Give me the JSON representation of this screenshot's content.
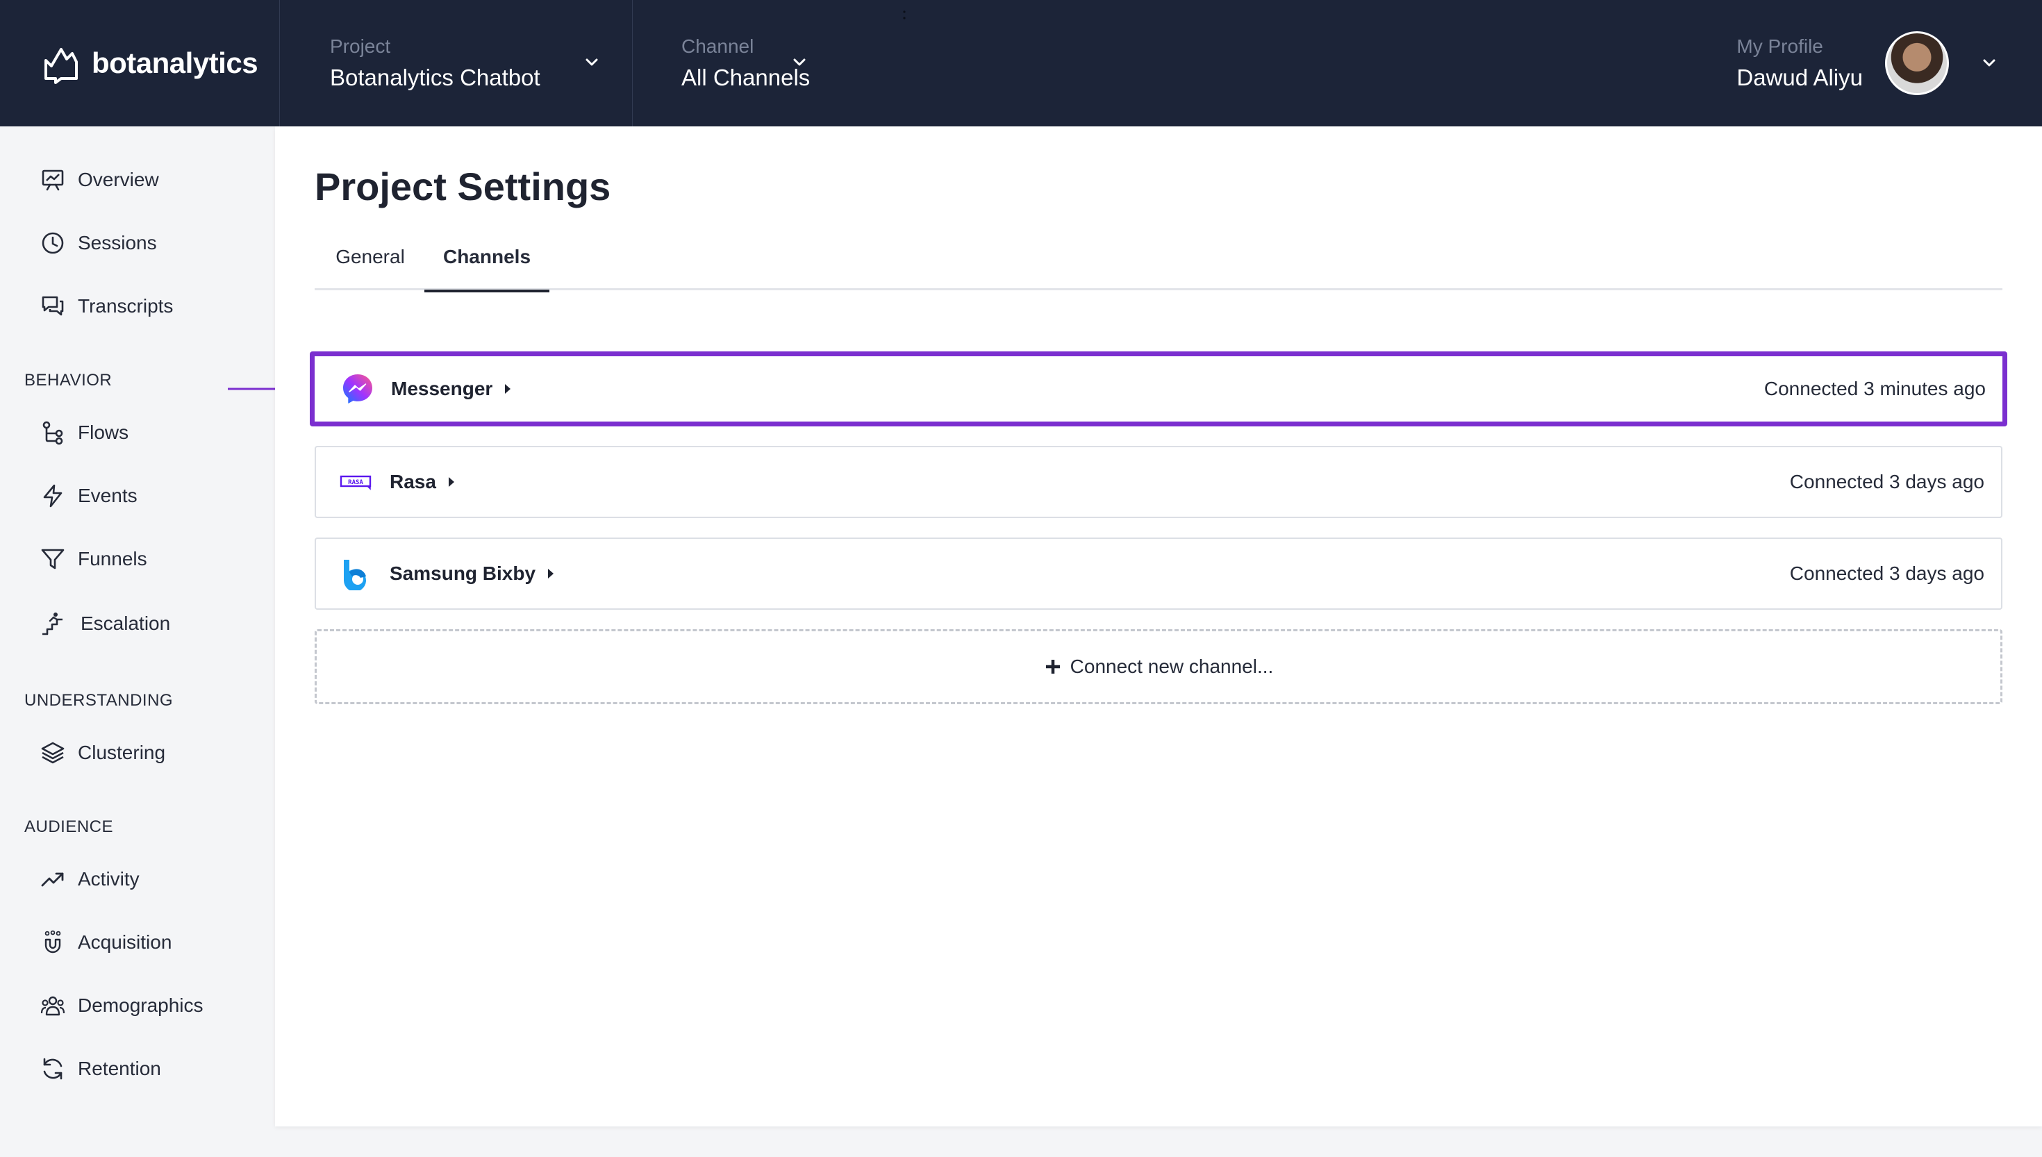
{
  "colors": {
    "topbar_bg": "#1c2438",
    "highlight_border": "#7b2fcf",
    "text_dark": "#1f2330"
  },
  "brand": {
    "name": "botanalytics",
    "icon": "botanalytics-logo-icon"
  },
  "header": {
    "project": {
      "label": "Project",
      "value": "Botanalytics Chatbot"
    },
    "channel": {
      "label": "Channel",
      "value": "All Channels"
    },
    "profile": {
      "label": "My Profile",
      "name": "Dawud Aliyu"
    }
  },
  "sidebar": {
    "top_items": [
      {
        "label": "Overview",
        "icon": "presentation-chart-icon"
      },
      {
        "label": "Sessions",
        "icon": "clock-icon"
      },
      {
        "label": "Transcripts",
        "icon": "chat-bubbles-icon"
      }
    ],
    "sections": [
      {
        "title": "BEHAVIOR",
        "items": [
          {
            "label": "Flows",
            "icon": "flow-icon"
          },
          {
            "label": "Events",
            "icon": "lightning-icon"
          },
          {
            "label": "Funnels",
            "icon": "funnel-icon"
          },
          {
            "label": "Escalation",
            "icon": "escalation-stairs-icon"
          }
        ]
      },
      {
        "title": "UNDERSTANDING",
        "items": [
          {
            "label": "Clustering",
            "icon": "layers-icon"
          }
        ]
      },
      {
        "title": "AUDIENCE",
        "items": [
          {
            "label": "Activity",
            "icon": "trend-up-icon"
          },
          {
            "label": "Acquisition",
            "icon": "magnet-icon"
          },
          {
            "label": "Demographics",
            "icon": "users-group-icon"
          },
          {
            "label": "Retention",
            "icon": "refresh-icon"
          }
        ]
      }
    ]
  },
  "main": {
    "title": "Project Settings",
    "tabs": [
      {
        "label": "General",
        "active": false
      },
      {
        "label": "Channels",
        "active": true
      }
    ],
    "channels": [
      {
        "name": "Messenger",
        "status": "Connected 3 minutes ago",
        "icon": "messenger-icon",
        "highlighted": true
      },
      {
        "name": "Rasa",
        "status": "Connected 3 days ago",
        "icon": "rasa-icon",
        "highlighted": false
      },
      {
        "name": "Samsung Bixby",
        "status": "Connected 3 days ago",
        "icon": "bixby-icon",
        "highlighted": false
      }
    ],
    "connect_new_label": "Connect new channel..."
  }
}
